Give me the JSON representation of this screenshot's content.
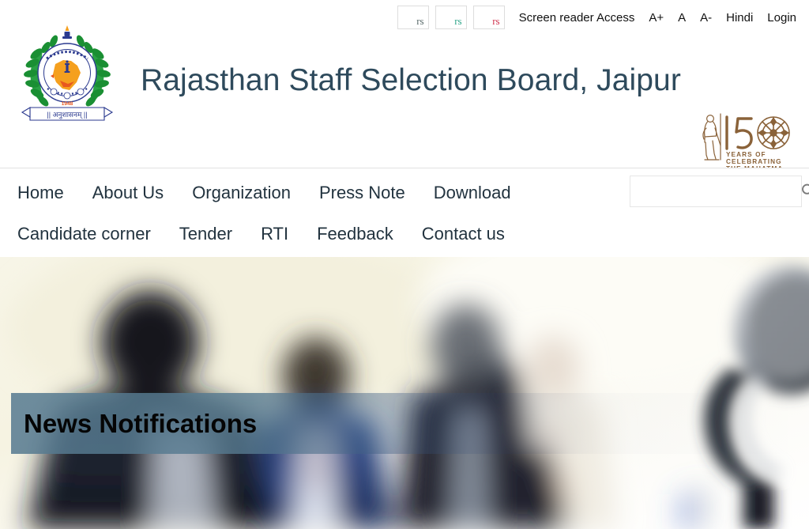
{
  "topbar": {
    "social_placeholders": [
      {
        "alt": "rs",
        "name": "broken-social-icon-1"
      },
      {
        "alt": "rs",
        "name": "broken-social-icon-2"
      },
      {
        "alt": "rs",
        "name": "broken-social-icon-3"
      }
    ],
    "links": [
      {
        "label": "Screen reader Access",
        "name": "screen-reader-access-link"
      },
      {
        "label": "A+",
        "name": "font-increase-link"
      },
      {
        "label": "A",
        "name": "font-normal-link"
      },
      {
        "label": "A-",
        "name": "font-decrease-link"
      },
      {
        "label": "Hindi",
        "name": "language-hindi-link"
      },
      {
        "label": "Login",
        "name": "login-link"
      }
    ]
  },
  "header": {
    "title": "Rajasthan Staff Selection Board, Jaipur",
    "emblem_alt": "Rajasthan Staff Selection Board Emblem",
    "gandhi_logo": {
      "number": "150",
      "line1": "YEARS OF",
      "line2": "CELEBRATING",
      "line3": "THE MAHATMA",
      "color": "#8a6239"
    }
  },
  "nav": {
    "row1": [
      {
        "label": "Home",
        "name": "nav-item-home"
      },
      {
        "label": "About Us",
        "name": "nav-item-about-us"
      },
      {
        "label": "Organization",
        "name": "nav-item-organization"
      },
      {
        "label": "Press Note",
        "name": "nav-item-press-note"
      },
      {
        "label": "Download",
        "name": "nav-item-download"
      }
    ],
    "row2": [
      {
        "label": "Candidate corner",
        "name": "nav-item-candidate-corner"
      },
      {
        "label": "Tender",
        "name": "nav-item-tender"
      },
      {
        "label": "RTI",
        "name": "nav-item-rti"
      },
      {
        "label": "Feedback",
        "name": "nav-item-feedback"
      },
      {
        "label": "Contact us",
        "name": "nav-item-contact-us"
      }
    ]
  },
  "search": {
    "value": "",
    "placeholder": "",
    "icon": "search-icon"
  },
  "hero": {
    "banner_title": "News Notifications",
    "image_alt": "Blurred photograph of officials in suits with a microphone",
    "banner_color": "#567a90"
  },
  "colors": {
    "title": "#2e4a5c",
    "nav_text": "#22333f",
    "banner_overlay": "#567a90",
    "gandhi_brown": "#8a6239"
  }
}
